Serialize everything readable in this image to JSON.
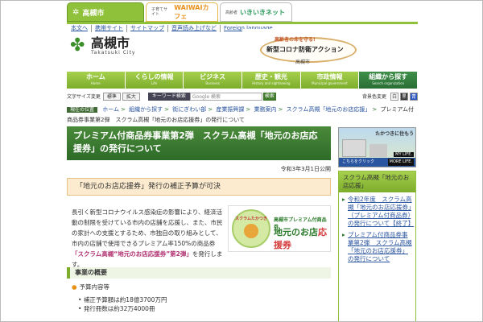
{
  "site_tabs": [
    {
      "label": "高槻市",
      "sub": "Takatsuki City"
    },
    {
      "label": "WAIWAIカフェ",
      "sub": "子育てサイト"
    },
    {
      "label": "いきいきネット",
      "sub": "高齢者"
    }
  ],
  "util_links": [
    "本文へ",
    "携帯サイト",
    "サイトマップ",
    "音声読み上げなど",
    "Foreign language"
  ],
  "logo": {
    "name": "高槻市",
    "en": "Takatsuki City"
  },
  "banner": {
    "line1": "高齢者の命を守る!",
    "line2": "新型コロナ防衛アクション",
    "line3": "高槻市"
  },
  "main_nav": [
    {
      "label": "ホーム",
      "sub": "Home"
    },
    {
      "label": "くらしの情報",
      "sub": "Life"
    },
    {
      "label": "ビジネス",
      "sub": "Business"
    },
    {
      "label": "歴史・観光",
      "sub": "History and sightseeing"
    },
    {
      "label": "市政情報",
      "sub": "Municipal government"
    },
    {
      "label": "組織から探す",
      "sub": "Search organization"
    }
  ],
  "tools": {
    "text_size_label": "文字サイズ変更",
    "std": "標準",
    "large": "拡大",
    "keyword_label": "キーワード検索",
    "search_placeholder": "Google 検索",
    "search_btn": "検索",
    "bg_label": "背景色変更",
    "bg_white": "白",
    "bg_black": "黒",
    "bg_blue": "青"
  },
  "breadcrumb": {
    "here": "現在の位置",
    "items": [
      "ホーム",
      "組織から探す",
      "街にぎわい部",
      "産業振興課",
      "業務案内",
      "スクラム高槻「地元のお店応援」",
      "プレミアム付商品券事業第2弾　スクラム高槻「地元のお店応援券」の発行について"
    ]
  },
  "page_title": "プレミアム付商品券事業第2弾　スクラム高槻「地元のお店応援券」の発行について",
  "pub_date": "令和3年3月1日公開",
  "notice": "「地元のお店応援券」発行の補正予算が可決",
  "body": {
    "para1": "長引く新型コロナウイルス感染症の影響により、経済活動の制限を受けている市内の店舗を応援し、また、市民の家計への支援とするため、市独自の取り組みとして、市内の店舗で使用できるプレミアム率150%の商品券",
    "highlight": "「スクラム高槻“地元のお店応援券”第2弾」",
    "para1_end": "を発行します。"
  },
  "promo": {
    "circle_text": "スクラムたかつき",
    "circle_bottom": "いっしょにね",
    "line1": "高槻市プレミアム付商品券",
    "line2a": "地元のお店",
    "line2b": "応援券"
  },
  "section_title": "事業の概要",
  "subheading": "予算内容等",
  "list_items": [
    "補正予算額は約18億3700万円",
    "発行冊数は約32万4000冊"
  ],
  "right_banner": {
    "title": "たかつきに住もう",
    "footer": "こちらをクリック",
    "my": "MY LIFE.",
    "more": "MORE LIFE."
  },
  "right_box": {
    "title": "スクラム高槻「地元のお店応援」",
    "links": [
      "令和2年度　スクラム高槻「地元のお店応援券」（プレミアム付商品券）の発行について【終了】",
      "プレミアム付商品券事業第2弾　スクラム高槻「地元のお店応援券」の発行について"
    ]
  }
}
